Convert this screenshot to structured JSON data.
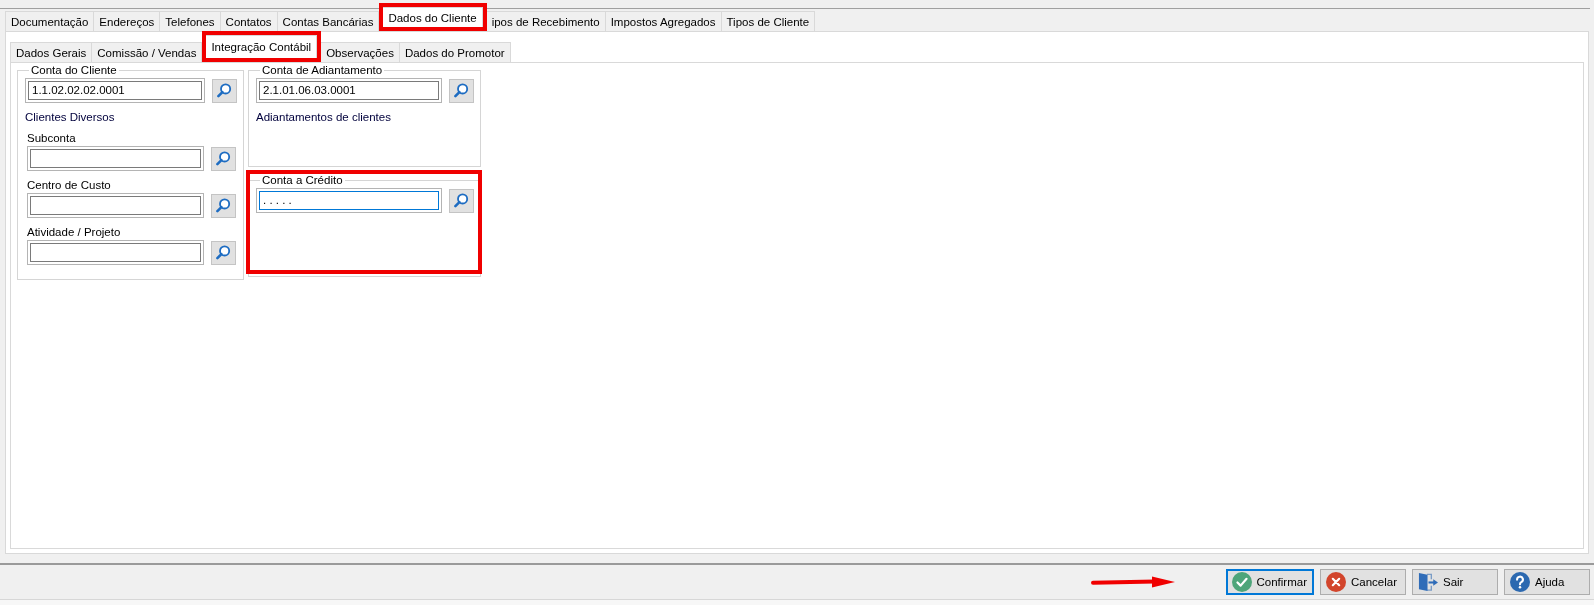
{
  "top_tabs": [
    {
      "label": "Documentação",
      "selected": false,
      "highlighted": false
    },
    {
      "label": "Endereços",
      "selected": false,
      "highlighted": false
    },
    {
      "label": "Telefones",
      "selected": false,
      "highlighted": false
    },
    {
      "label": "Contatos",
      "selected": false,
      "highlighted": false
    },
    {
      "label": "Contas Bancárias",
      "selected": false,
      "highlighted": false
    },
    {
      "label": "Dados do Cliente",
      "selected": true,
      "highlighted": true
    },
    {
      "label": "ipos de Recebimento",
      "selected": false,
      "highlighted": false
    },
    {
      "label": "Impostos Agregados",
      "selected": false,
      "highlighted": false
    },
    {
      "label": "Tipos de Cliente",
      "selected": false,
      "highlighted": false
    }
  ],
  "sub_tabs": [
    {
      "label": "Dados Gerais",
      "selected": false,
      "highlighted": false
    },
    {
      "label": "Comissão / Vendas",
      "selected": false,
      "highlighted": false
    },
    {
      "label": "Integração Contábil",
      "selected": true,
      "highlighted": true
    },
    {
      "label": "Observações",
      "selected": false,
      "highlighted": false
    },
    {
      "label": "Dados do Promotor",
      "selected": false,
      "highlighted": false
    }
  ],
  "left_group": {
    "title": "Conta do Cliente",
    "value": "1.1.02.02.02.0001",
    "description": "Clientes Diversos",
    "focused": false,
    "highlighted": false,
    "extra_fields": [
      {
        "label": "Subconta"
      },
      {
        "label": "Centro de Custo"
      },
      {
        "label": "Atividade / Projeto"
      }
    ]
  },
  "right_groups": [
    {
      "title": "Conta de Adiantamento",
      "value": "2.1.01.06.03.0001",
      "description": "Adiantamentos de clientes",
      "focused": false,
      "highlighted": false
    },
    {
      "title": "Conta a Crédito",
      "value": ". . . . .",
      "focused": true,
      "highlighted": true
    }
  ],
  "footer": {
    "arrow": true,
    "buttons": [
      {
        "label": "Confirmar",
        "kind": "confirm",
        "focused": true
      },
      {
        "label": "Cancelar",
        "kind": "cancel",
        "focused": false
      },
      {
        "label": "Sair",
        "kind": "exit",
        "focused": false
      },
      {
        "label": "Ajuda",
        "kind": "help",
        "focused": false
      }
    ]
  }
}
